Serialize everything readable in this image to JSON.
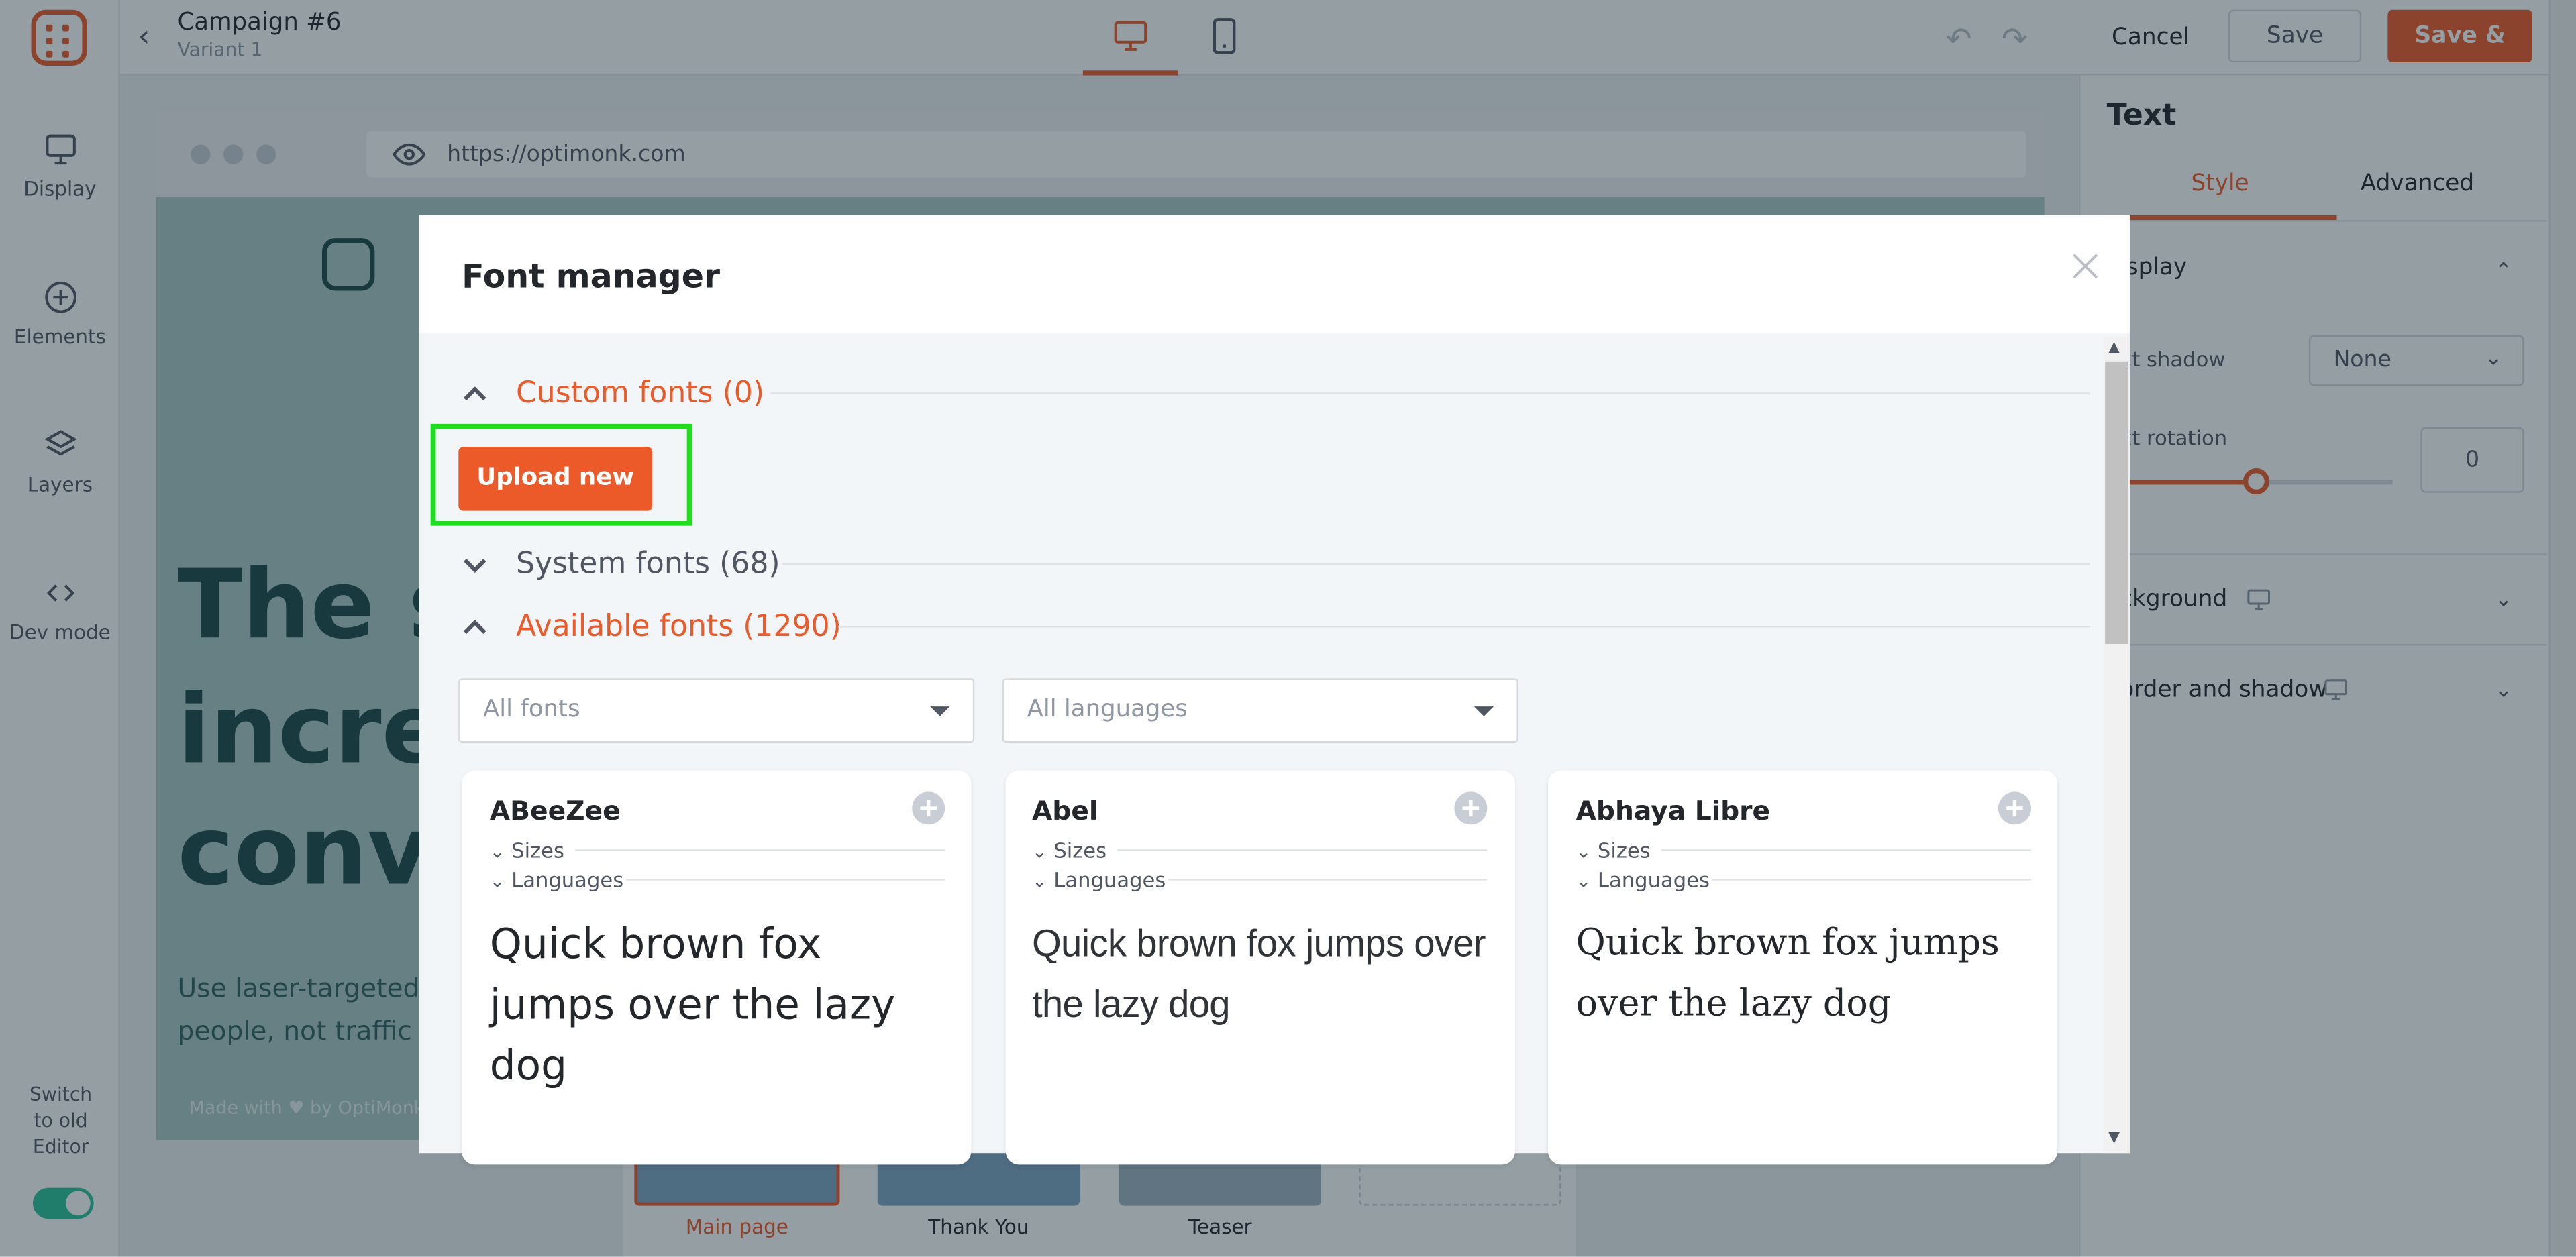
{
  "app": {
    "campaign_title": "Campaign #6",
    "variant": "Variant 1"
  },
  "sidebar": {
    "items": [
      {
        "label": "Display",
        "icon": "monitor-icon"
      },
      {
        "label": "Elements",
        "icon": "plus-circle-icon"
      },
      {
        "label": "Layers",
        "icon": "layers-icon"
      },
      {
        "label": "Dev mode",
        "icon": "code-icon"
      }
    ],
    "switch_label": "Switch to old Editor"
  },
  "toolbar": {
    "cancel": "Cancel",
    "save": "Save",
    "save_exit": "Save & Exit"
  },
  "right_panel": {
    "title": "Text",
    "tabs": [
      "Style",
      "Advanced"
    ],
    "sections": {
      "display": "isplay",
      "text_shadow": "xt shadow",
      "text_shadow_value": "None",
      "text_rotation": "xt rotation",
      "text_rotation_value": "0",
      "background": "ckground",
      "border_shadow": "order and shadow"
    }
  },
  "canvas": {
    "url": "https://optimonk.com",
    "headline": [
      "The s",
      "increa",
      "conve"
    ],
    "body": [
      "Use laser-targeted",
      "people, not traffic"
    ],
    "made_with": "Made with ♥ by OptiMonk",
    "pages": [
      "Main page",
      "Thank You",
      "Teaser"
    ]
  },
  "modal": {
    "title": "Font manager",
    "groups": {
      "custom": "Custom fonts (0)",
      "system": "System fonts (68)",
      "available": "Available fonts (1290)"
    },
    "upload_label": "Upload new",
    "filters": {
      "fonts": "All fonts",
      "languages": "All languages"
    },
    "cards": [
      {
        "name": "ABeeZee",
        "sizes": "Sizes",
        "languages": "Languages",
        "sample": "Quick brown fox jumps over the lazy dog"
      },
      {
        "name": "Abel",
        "sizes": "Sizes",
        "languages": "Languages",
        "sample": "Quick brown fox jumps over the lazy dog"
      },
      {
        "name": "Abhaya Libre",
        "sizes": "Sizes",
        "languages": "Languages",
        "sample": "Quick brown fox jumps over the lazy dog"
      }
    ]
  },
  "colors": {
    "accent": "#ed5a29",
    "highlight": "#1fdc1f",
    "toggle": "#2cc49a"
  }
}
